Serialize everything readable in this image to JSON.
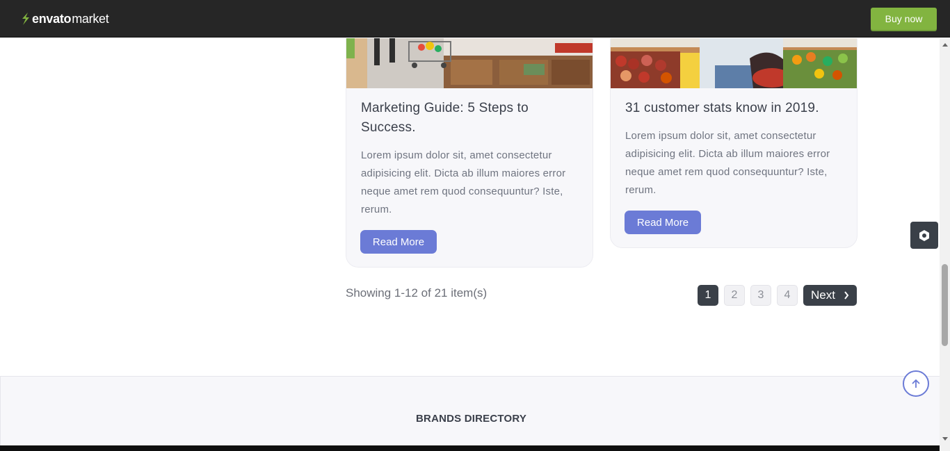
{
  "topbar": {
    "brand": "envato",
    "brand_suffix": "market",
    "buy_label": "Buy now",
    "accent": "#82b440"
  },
  "cards": [
    {
      "title": "Marketing Guide: 5 Steps to Success.",
      "text": "Lorem ipsum dolor sit, amet consectetur adipisicing elit. Dicta ab illum maiores error neque amet rem quod consequuntur? Iste, rerum.",
      "button": "Read More"
    },
    {
      "title": "31 customer stats know in 2019.",
      "text": "Lorem ipsum dolor sit, amet consectetur adipisicing elit. Dicta ab illum maiores error neque amet rem quod consequuntur? Iste, rerum.",
      "button": "Read More"
    }
  ],
  "pagination": {
    "summary": "Showing 1-12 of 21 item(s)",
    "pages": [
      "1",
      "2",
      "3",
      "4"
    ],
    "active_page": "1",
    "next_label": "Next"
  },
  "footer": {
    "heading": "BRANDS DIRECTORY"
  },
  "colors": {
    "button": "#6b7bd6",
    "dark": "#3a4048"
  },
  "icons": {
    "settings": "settings-hex-icon",
    "back_to_top": "arrow-up-icon",
    "next": "chevron-right-icon"
  }
}
